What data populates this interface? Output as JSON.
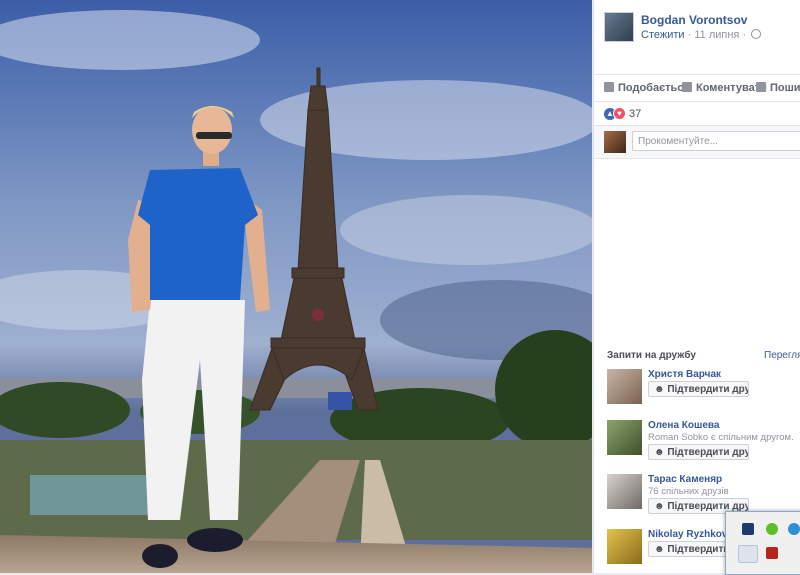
{
  "post": {
    "author": "Bogdan Vorontsov",
    "follow": "Стежити",
    "separator": "·",
    "date": "11 липня",
    "separator2": "·"
  },
  "actions": {
    "like": "Подобається",
    "comment": "Коментувати",
    "share": "Пошир"
  },
  "reactions": {
    "count": "37"
  },
  "comment_input": {
    "placeholder": "Прокоментуйте..."
  },
  "friend_requests": {
    "title": "Запити на дружбу",
    "see_all": "Перегля",
    "items": [
      {
        "name": "Христя Варчак",
        "subtitle": "",
        "button": "Підтвердити друга"
      },
      {
        "name": "Олена Кошева",
        "subtitle": "Roman Sobko є спільним другом.",
        "button": "Підтвердити друга"
      },
      {
        "name": "Тарас Каменяр",
        "subtitle": "76 спільних друзів",
        "button": "Підтвердити друга"
      },
      {
        "name": "Nikolay Ryzhkov",
        "subtitle": "",
        "button": "Підтвердити друга"
      }
    ]
  },
  "colors": {
    "link": "#365899",
    "sky": "#6a86b8",
    "shirt": "#1d63c9"
  }
}
